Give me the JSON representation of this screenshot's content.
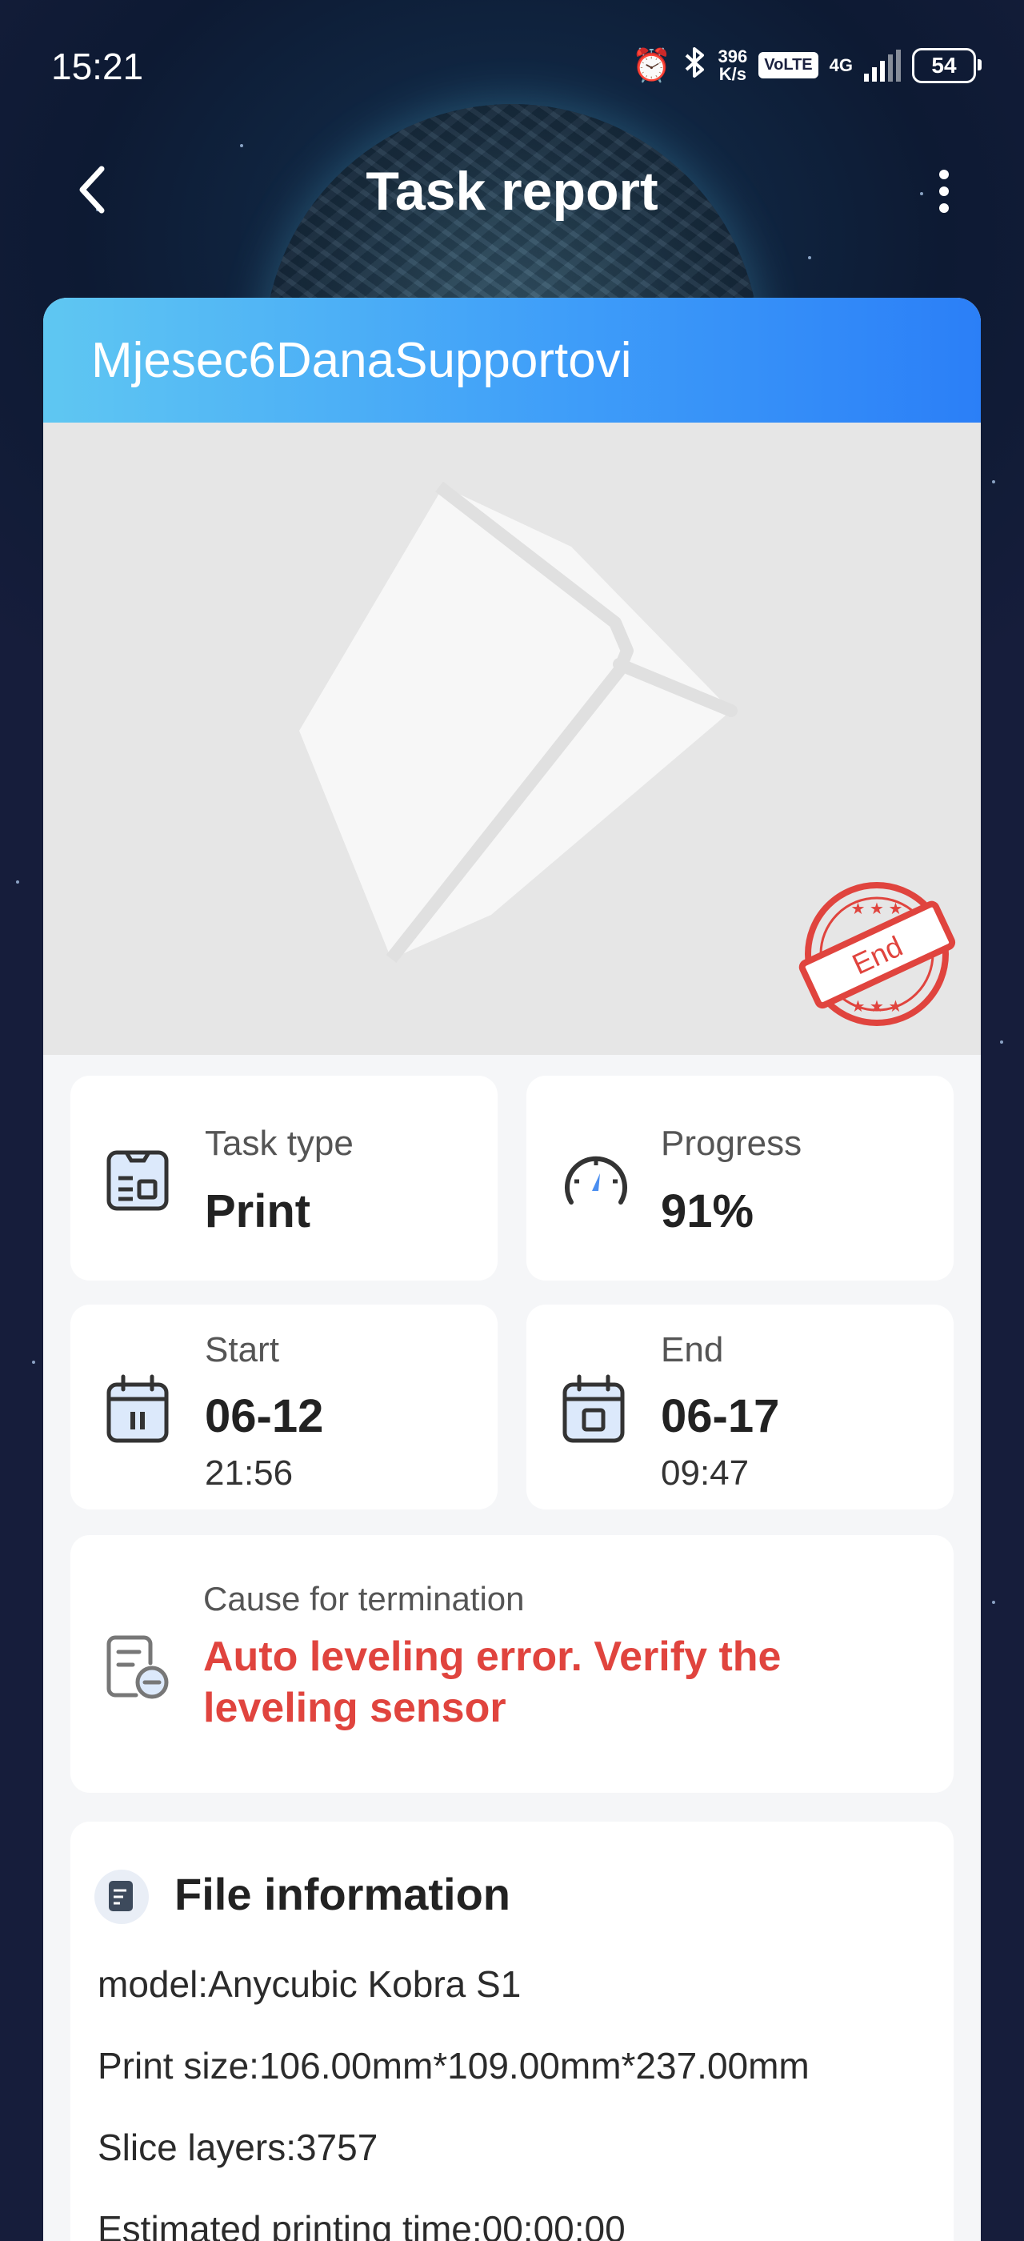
{
  "status_bar": {
    "time": "15:21",
    "speed_top": "396",
    "speed_bottom": "K/s",
    "volte": "VoLTE",
    "network": "4G",
    "battery": "54"
  },
  "header": {
    "title": "Task report"
  },
  "task": {
    "name": "Mjesec6DanaSupportovi",
    "stamp_text": "End",
    "type_label": "Task type",
    "type_value": "Print",
    "progress_label": "Progress",
    "progress_value": "91%",
    "start_label": "Start",
    "start_date": "06-12",
    "start_time": "21:56",
    "end_label": "End",
    "end_date": "06-17",
    "end_time": "09:47",
    "termination_label": "Cause for termination",
    "termination_line1": "Auto leveling error. Verify the",
    "termination_line2": "leveling sensor"
  },
  "file_info": {
    "title": "File information",
    "model": "model:Anycubic Kobra S1",
    "print_size": "Print size:106.00mm*109.00mm*237.00mm",
    "slice_layers": "Slice layers:3757",
    "estimated_time": "Estimated printing time:00:00:00"
  },
  "colors": {
    "accent_blue": "#3f9ef9",
    "error_red": "#e0443e",
    "icon_blue": "#4a8ef0"
  }
}
